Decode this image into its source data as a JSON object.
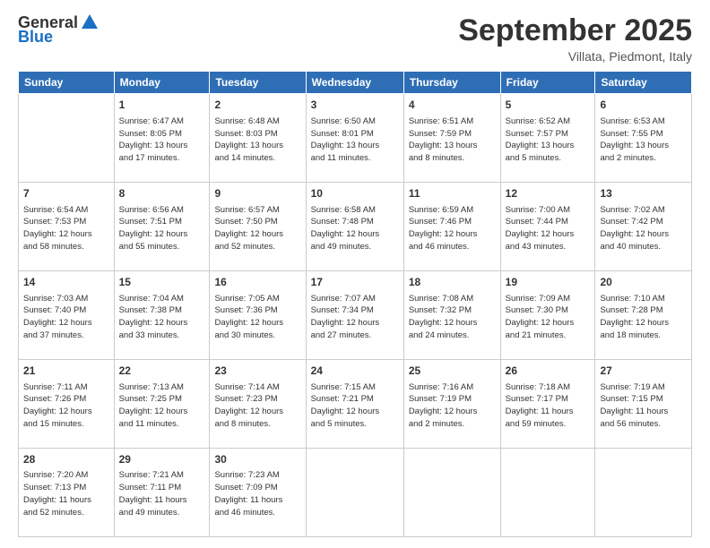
{
  "logo": {
    "general": "General",
    "blue": "Blue"
  },
  "title": "September 2025",
  "subtitle": "Villata, Piedmont, Italy",
  "days_of_week": [
    "Sunday",
    "Monday",
    "Tuesday",
    "Wednesday",
    "Thursday",
    "Friday",
    "Saturday"
  ],
  "weeks": [
    [
      {
        "day": "",
        "info": ""
      },
      {
        "day": "1",
        "info": "Sunrise: 6:47 AM\nSunset: 8:05 PM\nDaylight: 13 hours\nand 17 minutes."
      },
      {
        "day": "2",
        "info": "Sunrise: 6:48 AM\nSunset: 8:03 PM\nDaylight: 13 hours\nand 14 minutes."
      },
      {
        "day": "3",
        "info": "Sunrise: 6:50 AM\nSunset: 8:01 PM\nDaylight: 13 hours\nand 11 minutes."
      },
      {
        "day": "4",
        "info": "Sunrise: 6:51 AM\nSunset: 7:59 PM\nDaylight: 13 hours\nand 8 minutes."
      },
      {
        "day": "5",
        "info": "Sunrise: 6:52 AM\nSunset: 7:57 PM\nDaylight: 13 hours\nand 5 minutes."
      },
      {
        "day": "6",
        "info": "Sunrise: 6:53 AM\nSunset: 7:55 PM\nDaylight: 13 hours\nand 2 minutes."
      }
    ],
    [
      {
        "day": "7",
        "info": "Sunrise: 6:54 AM\nSunset: 7:53 PM\nDaylight: 12 hours\nand 58 minutes."
      },
      {
        "day": "8",
        "info": "Sunrise: 6:56 AM\nSunset: 7:51 PM\nDaylight: 12 hours\nand 55 minutes."
      },
      {
        "day": "9",
        "info": "Sunrise: 6:57 AM\nSunset: 7:50 PM\nDaylight: 12 hours\nand 52 minutes."
      },
      {
        "day": "10",
        "info": "Sunrise: 6:58 AM\nSunset: 7:48 PM\nDaylight: 12 hours\nand 49 minutes."
      },
      {
        "day": "11",
        "info": "Sunrise: 6:59 AM\nSunset: 7:46 PM\nDaylight: 12 hours\nand 46 minutes."
      },
      {
        "day": "12",
        "info": "Sunrise: 7:00 AM\nSunset: 7:44 PM\nDaylight: 12 hours\nand 43 minutes."
      },
      {
        "day": "13",
        "info": "Sunrise: 7:02 AM\nSunset: 7:42 PM\nDaylight: 12 hours\nand 40 minutes."
      }
    ],
    [
      {
        "day": "14",
        "info": "Sunrise: 7:03 AM\nSunset: 7:40 PM\nDaylight: 12 hours\nand 37 minutes."
      },
      {
        "day": "15",
        "info": "Sunrise: 7:04 AM\nSunset: 7:38 PM\nDaylight: 12 hours\nand 33 minutes."
      },
      {
        "day": "16",
        "info": "Sunrise: 7:05 AM\nSunset: 7:36 PM\nDaylight: 12 hours\nand 30 minutes."
      },
      {
        "day": "17",
        "info": "Sunrise: 7:07 AM\nSunset: 7:34 PM\nDaylight: 12 hours\nand 27 minutes."
      },
      {
        "day": "18",
        "info": "Sunrise: 7:08 AM\nSunset: 7:32 PM\nDaylight: 12 hours\nand 24 minutes."
      },
      {
        "day": "19",
        "info": "Sunrise: 7:09 AM\nSunset: 7:30 PM\nDaylight: 12 hours\nand 21 minutes."
      },
      {
        "day": "20",
        "info": "Sunrise: 7:10 AM\nSunset: 7:28 PM\nDaylight: 12 hours\nand 18 minutes."
      }
    ],
    [
      {
        "day": "21",
        "info": "Sunrise: 7:11 AM\nSunset: 7:26 PM\nDaylight: 12 hours\nand 15 minutes."
      },
      {
        "day": "22",
        "info": "Sunrise: 7:13 AM\nSunset: 7:25 PM\nDaylight: 12 hours\nand 11 minutes."
      },
      {
        "day": "23",
        "info": "Sunrise: 7:14 AM\nSunset: 7:23 PM\nDaylight: 12 hours\nand 8 minutes."
      },
      {
        "day": "24",
        "info": "Sunrise: 7:15 AM\nSunset: 7:21 PM\nDaylight: 12 hours\nand 5 minutes."
      },
      {
        "day": "25",
        "info": "Sunrise: 7:16 AM\nSunset: 7:19 PM\nDaylight: 12 hours\nand 2 minutes."
      },
      {
        "day": "26",
        "info": "Sunrise: 7:18 AM\nSunset: 7:17 PM\nDaylight: 11 hours\nand 59 minutes."
      },
      {
        "day": "27",
        "info": "Sunrise: 7:19 AM\nSunset: 7:15 PM\nDaylight: 11 hours\nand 56 minutes."
      }
    ],
    [
      {
        "day": "28",
        "info": "Sunrise: 7:20 AM\nSunset: 7:13 PM\nDaylight: 11 hours\nand 52 minutes."
      },
      {
        "day": "29",
        "info": "Sunrise: 7:21 AM\nSunset: 7:11 PM\nDaylight: 11 hours\nand 49 minutes."
      },
      {
        "day": "30",
        "info": "Sunrise: 7:23 AM\nSunset: 7:09 PM\nDaylight: 11 hours\nand 46 minutes."
      },
      {
        "day": "",
        "info": ""
      },
      {
        "day": "",
        "info": ""
      },
      {
        "day": "",
        "info": ""
      },
      {
        "day": "",
        "info": ""
      }
    ]
  ]
}
